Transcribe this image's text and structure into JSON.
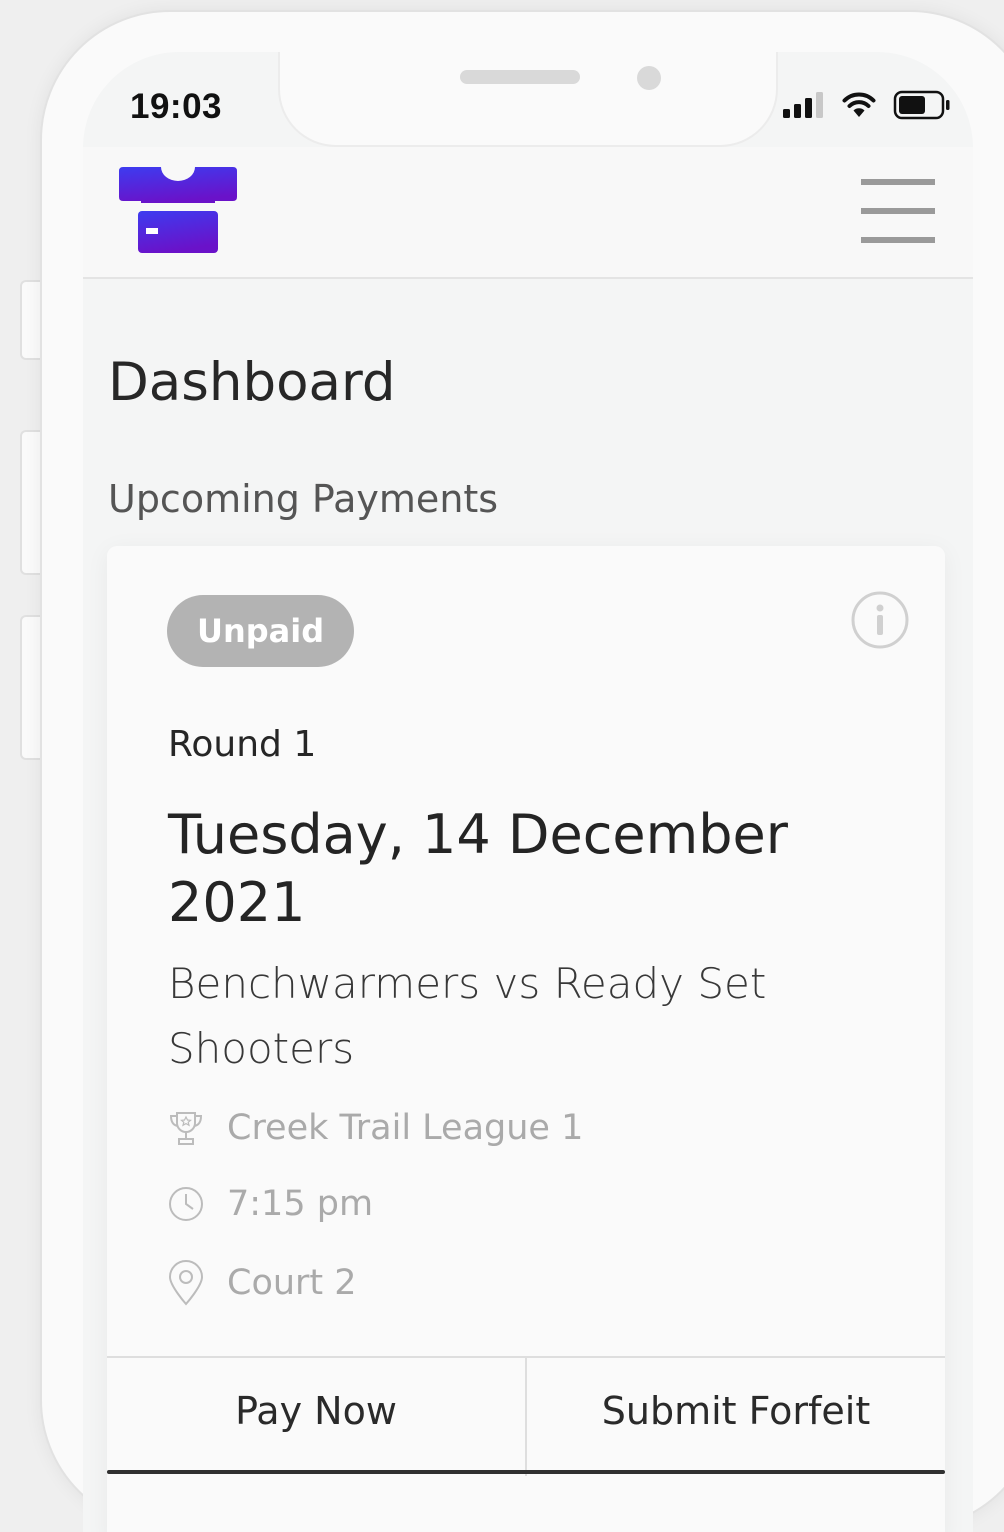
{
  "status_bar": {
    "time": "19:03",
    "icons": [
      "cellular-signal-icon",
      "wifi-icon",
      "battery-icon"
    ]
  },
  "header": {
    "logo_icon": "jersey-logo-icon",
    "menu_icon": "hamburger-menu-icon"
  },
  "page": {
    "title": "Dashboard",
    "section_title": "Upcoming Payments"
  },
  "payment_card": {
    "status": "Unpaid",
    "info_icon": "info-icon",
    "round": "Round 1",
    "date": "Tuesday, 14 December 2021",
    "teams": "Benchwarmers vs Ready Set Shooters",
    "league": "Creek Trail League 1",
    "time": "7:15 pm",
    "court": "Court 2",
    "actions": {
      "pay_label": "Pay Now",
      "forfeit_label": "Submit Forfeit"
    }
  },
  "colors": {
    "brand_gradient_start": "#3d3cf0",
    "brand_gradient_end": "#6a12c9",
    "badge_unpaid": "#b3b3b3",
    "muted_text": "#aaaaaa"
  }
}
